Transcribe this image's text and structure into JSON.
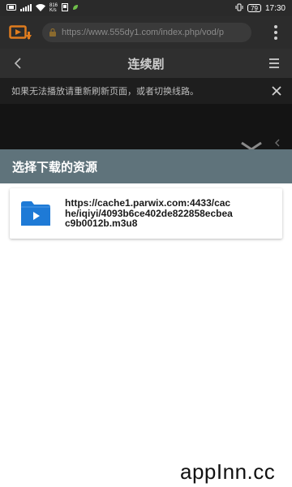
{
  "status_bar": {
    "net_speed_value": "816",
    "net_speed_unit": "K/s",
    "battery": "79",
    "time": "17:30"
  },
  "browser": {
    "url": "https://www.555dy1.com/index.php/vod/p"
  },
  "page": {
    "title": "连续剧"
  },
  "notice": {
    "text": "如果无法播放请重新刷新页面，或者切换线路。"
  },
  "download_sheet": {
    "title": "选择下载的资源",
    "sources": [
      {
        "url": "https://cache1.parwix.com:4433/cache/iqiyi/4093b6ce402de822858ecbeac9b0012b.m3u8",
        "icon": "video-file-icon"
      }
    ]
  },
  "watermark": "appInn.cc",
  "colors": {
    "sheet_header": "#5f737b",
    "video_icon": "#1e7ad6",
    "brand_orange": "#e07c1e"
  }
}
